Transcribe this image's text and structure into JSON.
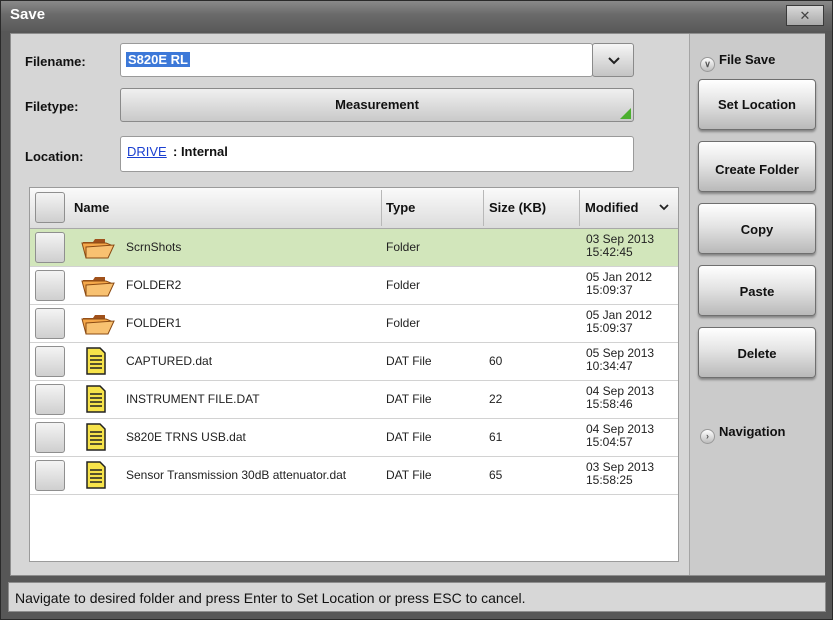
{
  "window": {
    "title": "Save",
    "close_label": "✕"
  },
  "form": {
    "filename_label": "Filename:",
    "filename_value": "S820E RL",
    "filetype_label": "Filetype:",
    "filetype_value": "Measurement",
    "location_label": "Location:",
    "location_drive": "DRIVE",
    "location_value": ": Internal"
  },
  "table": {
    "columns": [
      "Name",
      "Type",
      "Size (KB)",
      "Modified"
    ],
    "rows": [
      {
        "name": "ScrnShots",
        "type": "Folder",
        "size": "",
        "date": "03 Sep 2013",
        "time": "15:42:45",
        "icon": "folder-icon"
      },
      {
        "name": "FOLDER2",
        "type": "Folder",
        "size": "",
        "date": "05 Jan 2012",
        "time": "15:09:37",
        "icon": "folder-icon"
      },
      {
        "name": "FOLDER1",
        "type": "Folder",
        "size": "",
        "date": "05 Jan 2012",
        "time": "15:09:37",
        "icon": "folder-icon"
      },
      {
        "name": "CAPTURED.dat",
        "type": "DAT File",
        "size": "60",
        "date": "05 Sep 2013",
        "time": "10:34:47",
        "icon": "file-icon"
      },
      {
        "name": "INSTRUMENT FILE.DAT",
        "type": "DAT File",
        "size": "22",
        "date": "04 Sep 2013",
        "time": "15:58:46",
        "icon": "file-icon"
      },
      {
        "name": "S820E TRNS USB.dat",
        "type": "DAT File",
        "size": "61",
        "date": "04 Sep 2013",
        "time": "15:04:57",
        "icon": "file-icon"
      },
      {
        "name": "Sensor Transmission 30dB attenuator.dat",
        "type": "DAT File",
        "size": "65",
        "date": "03 Sep 2013",
        "time": "15:58:25",
        "icon": "file-icon"
      }
    ]
  },
  "sidebar": {
    "file_save_label": "File Save",
    "buttons": [
      "Set Location",
      "Create Folder",
      "Copy",
      "Paste",
      "Delete"
    ],
    "navigation_label": "Navigation"
  },
  "status": {
    "message": "Navigate to desired folder and press Enter to Set Location or press ESC to cancel."
  },
  "colors": {
    "selected_row": "#d2e6bb",
    "title_bar": "#6a6a6a",
    "accent_green": "#4caf2f",
    "link_blue": "#1a3fd0"
  }
}
